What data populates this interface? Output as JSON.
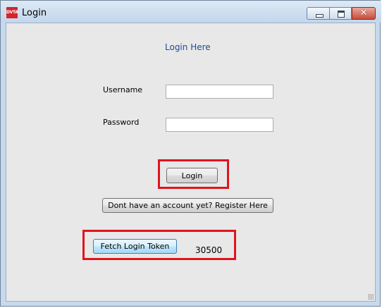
{
  "window": {
    "title": "Login",
    "app_icon_text": "DVTA",
    "minimize_glyph": "minimize-icon",
    "maximize_glyph": "maximize-icon",
    "close_glyph": "✕"
  },
  "form": {
    "heading": "Login Here",
    "username_label": "Username",
    "username_value": "",
    "password_label": "Password",
    "password_value": "",
    "login_button": "Login",
    "register_button": "Dont have an account yet? Register Here",
    "fetch_token_button": "Fetch Login Token",
    "token_value": "30500"
  },
  "colors": {
    "heading": "#1f4b92",
    "highlight_box": "#e0141e",
    "client_background": "#e8e8e8"
  }
}
